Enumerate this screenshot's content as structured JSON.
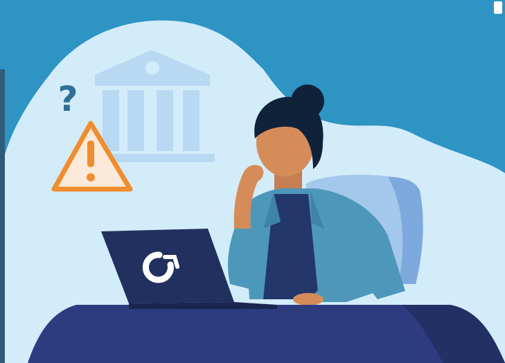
{
  "illustration": {
    "question_mark_text": "?",
    "laptop_logo_icon": "pie-chart-logo-icon",
    "colors": {
      "background_blue": "#2e94c3",
      "cloud_light": "#d3ecfa",
      "bank_icon": "#b9d9f2",
      "warning_orange": "#f08d2e",
      "desk_navy": "#2d3b7f",
      "laptop_navy": "#223060",
      "jacket_teal": "#4d98ba",
      "chair_blue": "#a3c8ec",
      "skin_tan": "#d68c59",
      "hair_dark": "#10223a"
    }
  }
}
